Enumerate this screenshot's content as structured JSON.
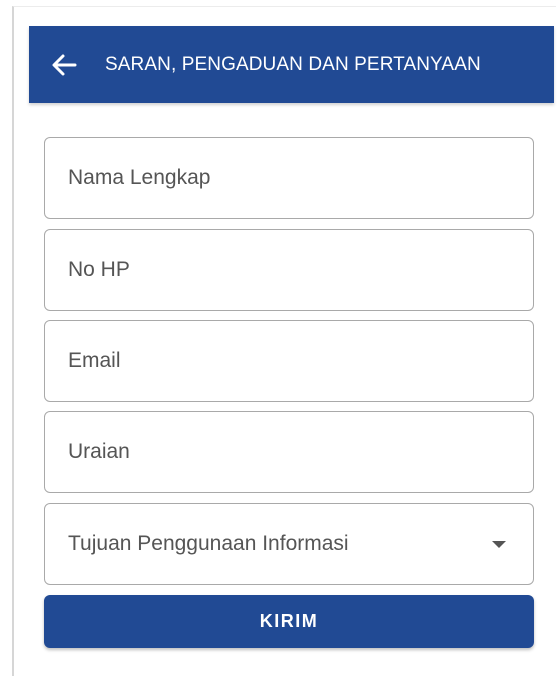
{
  "appbar": {
    "back_icon": "arrow-left-icon",
    "title": "SARAN, PENGADUAN DAN PERTANYAAN"
  },
  "form": {
    "fields": [
      {
        "placeholder": "Nama Lengkap",
        "value": ""
      },
      {
        "placeholder": "No HP",
        "value": ""
      },
      {
        "placeholder": "Email",
        "value": ""
      },
      {
        "placeholder": "Uraian",
        "value": ""
      }
    ],
    "select": {
      "label": "Tujuan Penggunaan Informasi",
      "icon": "dropdown-arrow-icon"
    },
    "submit_label": "KIRIM"
  },
  "colors": {
    "primary": "#214a94",
    "border": "#a9a9a9",
    "placeholder": "#555555"
  }
}
